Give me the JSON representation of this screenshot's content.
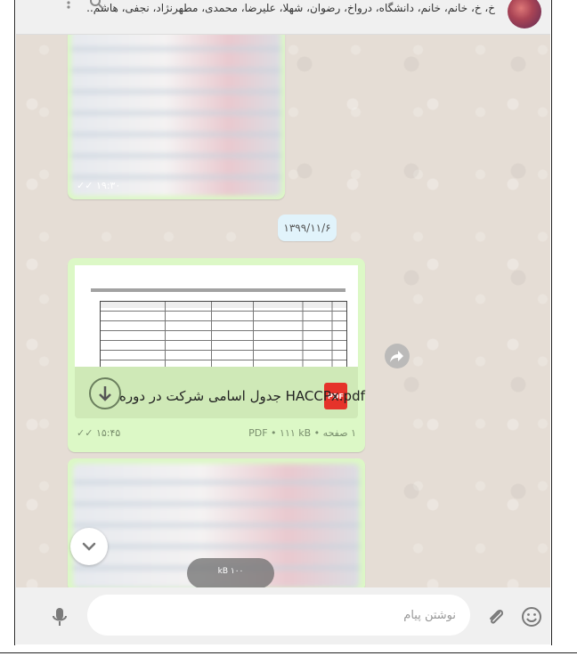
{
  "header": {
    "members": "خ، خ، خانم، خانم، دانشگاه، درواخ، رضوان، شهلا، علیرضا، محمدی، مطهرنژاد، نجفی، هاشم..."
  },
  "messages": {
    "image1_time": "۱۹:۳۰",
    "date_separator": "۱۳۹۹/۱۱/۶",
    "document": {
      "file_name": "جدول اسامی شرکت در دوره HACCPx.pdf",
      "type_badge": "PDF",
      "meta": "۱ صفحه • PDF • ۱۱۱ kB",
      "time": "۱۵:۴۵"
    },
    "pending_upload": "kB ۱۰۰"
  },
  "composer": {
    "placeholder": "نوشتن پیام"
  },
  "icons": {
    "search": "search-icon",
    "menu": "menu-icon",
    "download": "download-icon",
    "forward": "forward-icon",
    "scroll_down": "chevron-down-icon",
    "emoji": "emoji-icon",
    "attach": "paperclip-icon",
    "mic": "microphone-icon"
  },
  "colors": {
    "outgoing_bubble": "#dcf8c6",
    "chat_background": "#e5ddd5",
    "pdf_badge": "#e5332a",
    "header_bg": "#f0f0f0"
  }
}
